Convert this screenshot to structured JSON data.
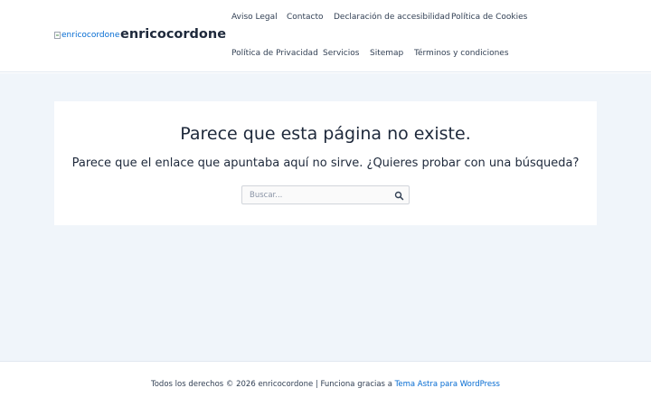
{
  "header": {
    "logo_alt": "enricocordone",
    "site_title": "enricocordone",
    "nav": [
      "Aviso Legal",
      "Contacto",
      "Declaración de accesibilidad",
      "Política de Cookies",
      "Política de Privacidad",
      "Servicios",
      "Sitemap",
      "Términos y condiciones"
    ]
  },
  "main": {
    "title": "Parece que esta página no existe.",
    "message": "Parece que el enlace que apuntaba aquí no sirve. ¿Quieres probar con una búsqueda?",
    "search": {
      "placeholder": "Buscar...",
      "value": "",
      "button_icon": "search-icon"
    }
  },
  "footer": {
    "text": "Todos los derechos © 2026 enricocordone | Funciona gracias a ",
    "link_label": "Tema Astra para WordPress"
  },
  "colors": {
    "accent": "#046bd2",
    "text": "#1e293b",
    "content_background": "#f0f5fa"
  }
}
